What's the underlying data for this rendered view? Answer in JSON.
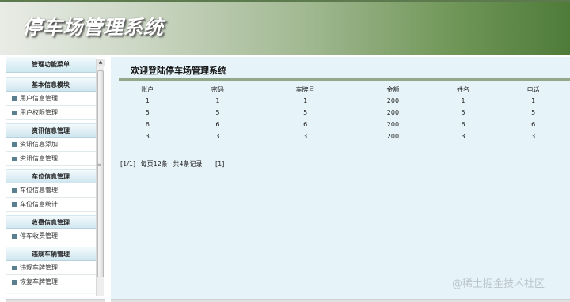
{
  "header": {
    "title": "停车场管理系统"
  },
  "sidebar": {
    "menu_title": "管理功能菜单",
    "groups": [
      {
        "title": "基本信息模块",
        "items": [
          "用户信息管理",
          "用户权限管理"
        ]
      },
      {
        "title": "资讯信息管理",
        "items": [
          "资讯信息添加",
          "资讯信息管理"
        ]
      },
      {
        "title": "车位信息管理",
        "items": [
          "车位信息管理",
          "车位信息统计"
        ]
      },
      {
        "title": "收费信息管理",
        "items": [
          "停车收费管理"
        ]
      },
      {
        "title": "违规车辆管理",
        "items": [
          "违规车牌管理",
          "恢复车牌管理"
        ]
      },
      {
        "title": "违规车辆管理",
        "items": []
      }
    ]
  },
  "main": {
    "welcome": "欢迎登陆停车场管理系统",
    "table": {
      "columns": [
        "账户",
        "密码",
        "车牌号",
        "金额",
        "姓名",
        "电话"
      ],
      "rows": [
        [
          "1",
          "1",
          "1",
          "200",
          "1",
          "1"
        ],
        [
          "5",
          "5",
          "5",
          "200",
          "5",
          "5"
        ],
        [
          "6",
          "6",
          "6",
          "200",
          "6",
          "6"
        ],
        [
          "3",
          "3",
          "3",
          "200",
          "3",
          "3"
        ]
      ]
    },
    "pager": {
      "page_info": "[1/1]",
      "per_page": "每页12条",
      "total": "共4条记录",
      "page_link": "[1]"
    }
  },
  "watermark": "@稀土掘金技术社区"
}
